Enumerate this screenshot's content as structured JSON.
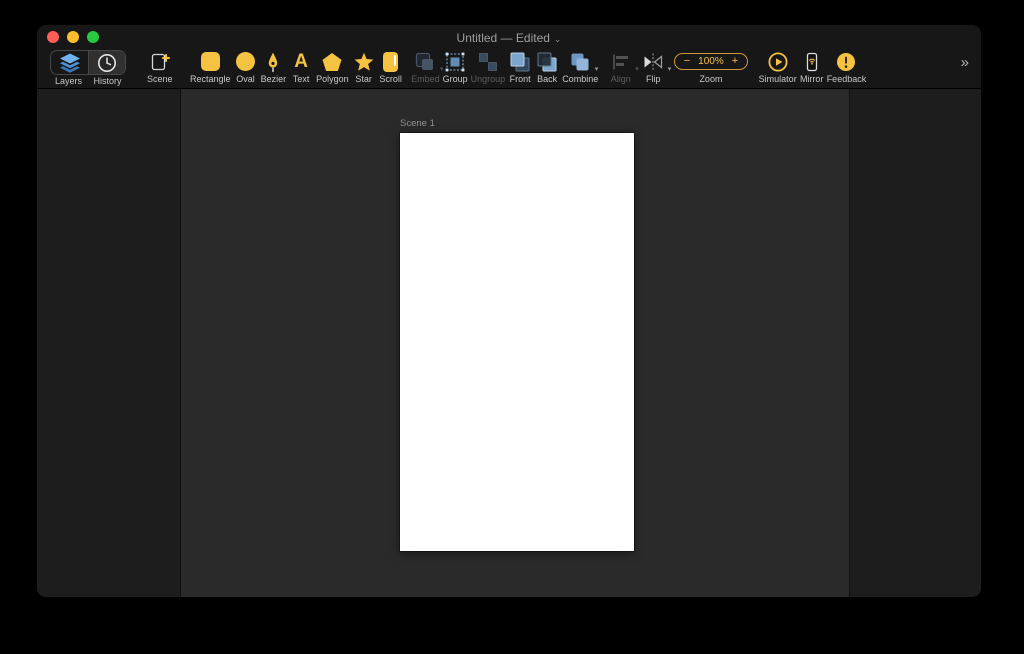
{
  "window": {
    "title": "Untitled — Edited",
    "title_chevron": "⌄"
  },
  "toolbar": {
    "items": [
      {
        "label": "Layers",
        "active": false
      },
      {
        "label": "History",
        "active": true
      },
      {
        "label": "Scene"
      },
      {
        "label": "Rectangle"
      },
      {
        "label": "Oval"
      },
      {
        "label": "Bezier"
      },
      {
        "label": "Text"
      },
      {
        "label": "Polygon"
      },
      {
        "label": "Star"
      },
      {
        "label": "Scroll"
      },
      {
        "label": "Embed",
        "disabled": true
      },
      {
        "label": "Group"
      },
      {
        "label": "Ungroup",
        "disabled": true
      },
      {
        "label": "Front"
      },
      {
        "label": "Back"
      },
      {
        "label": "Combine"
      },
      {
        "label": "Align",
        "disabled": true
      },
      {
        "label": "Flip"
      },
      {
        "label": "Simulator"
      },
      {
        "label": "Mirror"
      },
      {
        "label": "Feedback"
      }
    ],
    "text_glyph": "A",
    "zoom": {
      "minus": "−",
      "value": "100%",
      "plus": "+",
      "label": "Zoom"
    },
    "overflow": "»"
  },
  "canvas": {
    "scene_label": "Scene 1"
  },
  "colors": {
    "accent_yellow": "#f5c242",
    "icon_blue": "#7da2c6",
    "traffic_close": "#ff5f57",
    "traffic_minimize": "#febc2e",
    "traffic_zoom": "#28c840",
    "canvas_bg": "#2a2a2a",
    "artboard_bg": "#ffffff"
  }
}
